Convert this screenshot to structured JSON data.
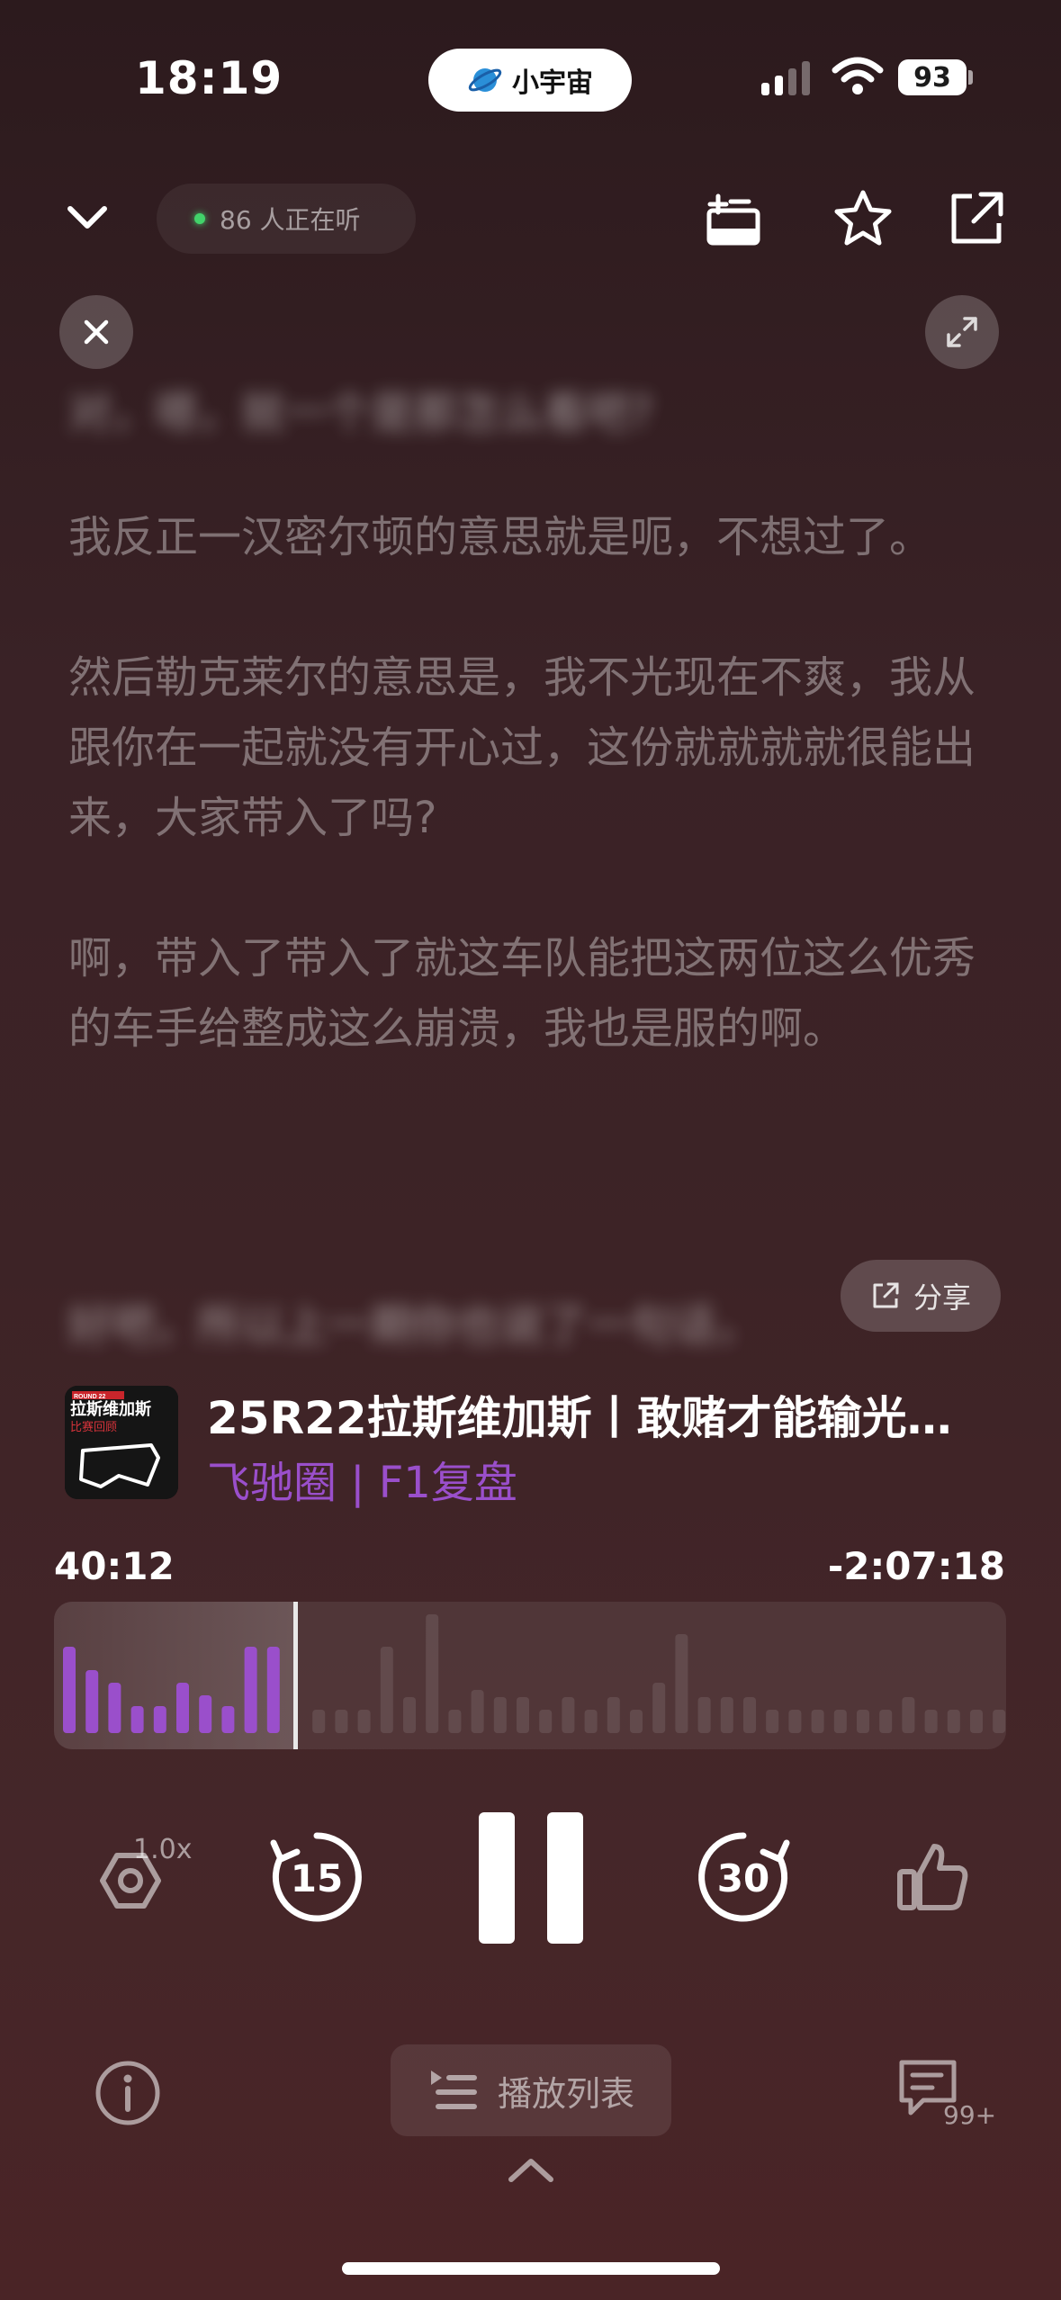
{
  "status_bar": {
    "time": "18:19",
    "island_label": "小宇宙",
    "battery": "93"
  },
  "header": {
    "listeners": "86 人正在听"
  },
  "transcript": {
    "blurred_top": "对，嗯，就一个是那怎么看吧?",
    "paragraphs": [
      "我反正一汉密尔顿的意思就是呃，不想过了。",
      "然后勒克莱尔的意思是，我不光现在不爽，我从跟你在一起就没有开心过，这份就就就就很能出来，大家带入了吗?",
      "啊，带入了带入了就这车队能把这两位这么优秀的车手给整成这么崩溃，我也是服的啊。"
    ],
    "blurred_bottom": "好吧，所以上一期你也说了一句话，",
    "share_label": "分享"
  },
  "episode": {
    "title": "25R22拉斯维加斯丨敢赌才能输光…",
    "podcast": "飞驰圈 | F1复盘",
    "cover": {
      "round": "ROUND 22",
      "name": "拉斯维加斯",
      "tag": "比赛回顾"
    }
  },
  "player": {
    "position": "40:12",
    "remaining": "-2:07:18",
    "progress_fraction": 0.255,
    "speed": "1.0x",
    "rewind_seconds": "15",
    "forward_seconds": "30",
    "playlist_label": "播放列表",
    "comments_count": "99+"
  },
  "colors": {
    "accent_purple": "#9a4fcb",
    "played_bar": "#9a4fcb",
    "live_dot": "#42d36a"
  }
}
